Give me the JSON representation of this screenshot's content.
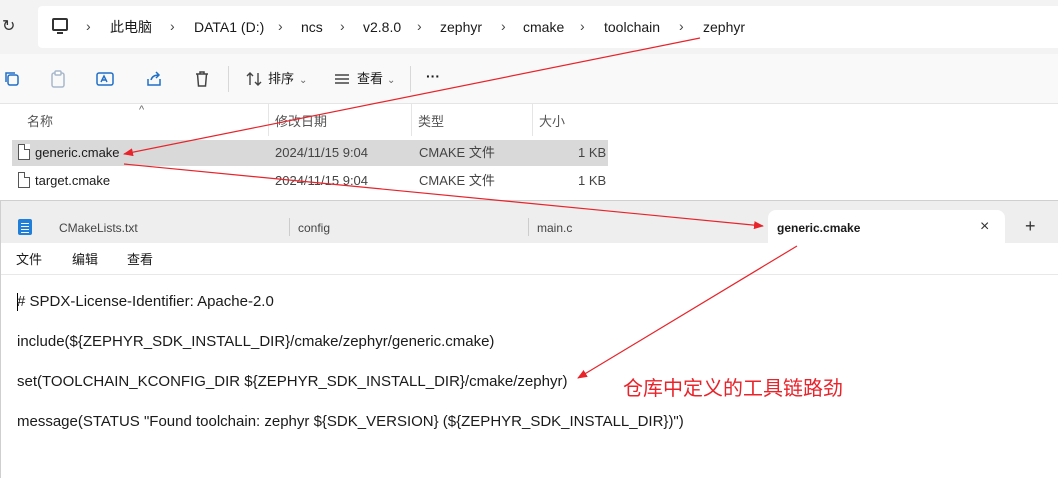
{
  "explorer": {
    "breadcrumbs": [
      "此电脑",
      "DATA1 (D:)",
      "ncs",
      "v2.8.0",
      "zephyr",
      "cmake",
      "toolchain",
      "zephyr"
    ],
    "toolbar": {
      "sort_label": "排序",
      "view_label": "查看",
      "more_label": "···"
    },
    "columns": [
      "名称",
      "修改日期",
      "类型",
      "大小"
    ],
    "files": [
      {
        "name": "generic.cmake",
        "modified": "2024/11/15 9:04",
        "type": "CMAKE 文件",
        "size": "1 KB",
        "selected": true
      },
      {
        "name": "target.cmake",
        "modified": "2024/11/15 9:04",
        "type": "CMAKE 文件",
        "size": "1 KB",
        "selected": false
      }
    ]
  },
  "notepad": {
    "tabs": [
      {
        "label": "CMakeLists.txt"
      },
      {
        "label": "config"
      },
      {
        "label": "main.c"
      },
      {
        "label": "generic.cmake",
        "active": true
      }
    ],
    "close_glyph": "×",
    "new_tab_glyph": "+",
    "menu": [
      "文件",
      "编辑",
      "查看"
    ],
    "lines": [
      "# SPDX-License-Identifier: Apache-2.0",
      "include(${ZEPHYR_SDK_INSTALL_DIR}/cmake/zephyr/generic.cmake)",
      "set(TOOLCHAIN_KCONFIG_DIR ${ZEPHYR_SDK_INSTALL_DIR}/cmake/zephyr)",
      "message(STATUS \"Found toolchain: zephyr ${SDK_VERSION} (${ZEPHYR_SDK_INSTALL_DIR})\")"
    ]
  },
  "annotation": {
    "text": "仓库中定义的工具链路劲",
    "color": "#e8232a"
  }
}
